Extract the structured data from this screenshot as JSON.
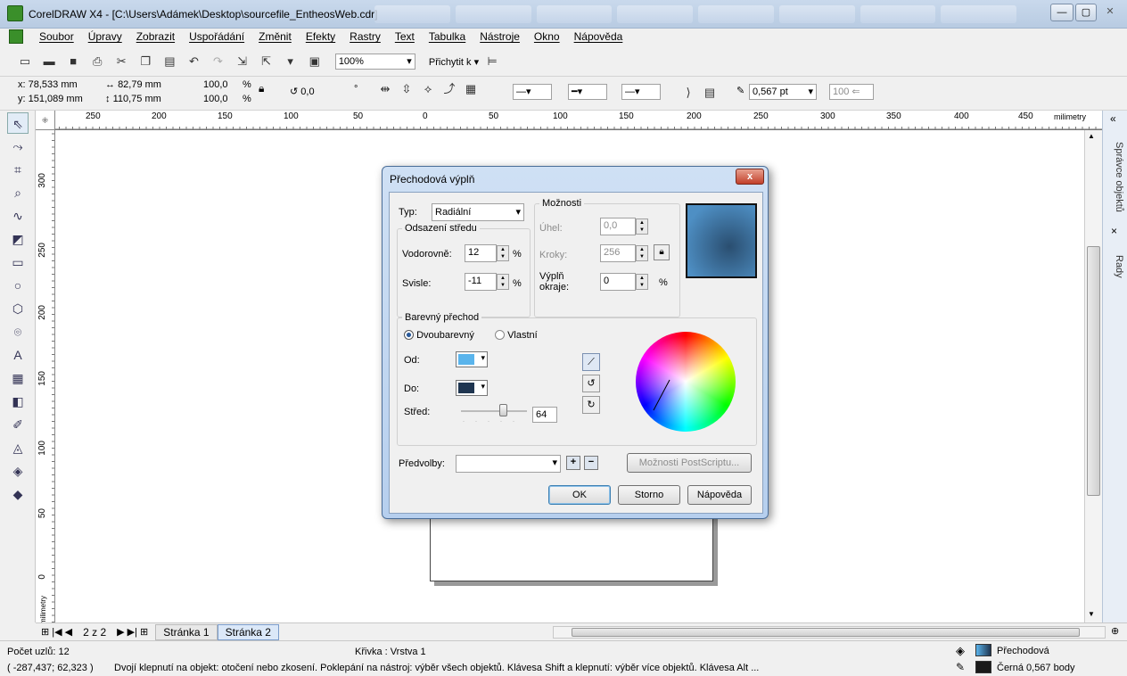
{
  "window": {
    "title": "CorelDRAW X4 - [C:\\Users\\Adámek\\Desktop\\sourcefile_EntheosWeb.cdr]",
    "minimize": "—",
    "maximize": "▢",
    "close": "✕"
  },
  "menu": {
    "items": [
      "Soubor",
      "Úpravy",
      "Zobrazit",
      "Uspořádání",
      "Změnit",
      "Efekty",
      "Rastry",
      "Text",
      "Tabulka",
      "Nástroje",
      "Okno",
      "Nápověda"
    ]
  },
  "toolbar": {
    "zoom": "100%",
    "snap": "Přichytit k"
  },
  "propbar": {
    "x": "x: 78,533 mm",
    "y": "y: 151,089 mm",
    "width": "82,79 mm",
    "height": "110,75 mm",
    "scale_x": "100,0",
    "scale_y": "100,0",
    "pct": "%",
    "rotation": "0,0",
    "deg": "°",
    "outline_width": "0,567 pt",
    "opacity": "100"
  },
  "ruler": {
    "unit": "milimetry",
    "h_ticks": [
      "250",
      "200",
      "150",
      "100",
      "50",
      "0",
      "50",
      "100",
      "150",
      "200",
      "250",
      "300",
      "350",
      "400",
      "450"
    ],
    "v_ticks": [
      "300",
      "250",
      "200",
      "150",
      "100",
      "50",
      "0"
    ],
    "v_unit": "milimetry"
  },
  "docker": {
    "tab1": "Správce objektů",
    "tab2": "Rady",
    "collapse": "«"
  },
  "pagebar": {
    "page_count": "2 z 2",
    "pages": [
      "Stránka 1",
      "Stránka 2"
    ]
  },
  "status": {
    "nodes": "Počet uzlů: 12",
    "layer": "Křivka : Vrstva 1",
    "coords": "( -287,437; 62,323 )",
    "hint": "Dvojí klepnutí na objekt: otočení nebo zkosení. Poklepání na nástroj: výběr všech objektů. Klávesa Shift a klepnutí: výběr více objektů. Klávesa Alt ...",
    "fill": "Přechodová",
    "outline": "Černá  0,567 body"
  },
  "dialog": {
    "title": "Přechodová výplň",
    "close": "x",
    "type_label": "Typ:",
    "type_value": "Radiální",
    "center_offset": "Odsazení středu",
    "horizontal_label": "Vodorovně:",
    "horizontal_value": "12",
    "vertical_label": "Svisle:",
    "vertical_value": "-11",
    "percent": "%",
    "options": "Možnosti",
    "angle_label": "Úhel:",
    "angle_value": "0,0",
    "steps_label": "Kroky:",
    "steps_value": "256",
    "edge_label": "Výplň okraje:",
    "edge_value": "0",
    "color_blend": "Barevný přechod",
    "two_color": "Dvoubarevný",
    "custom": "Vlastní",
    "from_label": "Od:",
    "to_label": "Do:",
    "mid_label": "Střed:",
    "mid_value": "64",
    "presets_label": "Předvolby:",
    "presets_value": "",
    "postscript": "Možnosti PostScriptu...",
    "ok": "OK",
    "cancel": "Storno",
    "help": "Nápověda",
    "from_color": "#5ab4ec",
    "to_color": "#1f3550",
    "preview_center": "#2a4e70",
    "preview_edge": "#4e8fc4",
    "midpoint_percent": 64
  }
}
